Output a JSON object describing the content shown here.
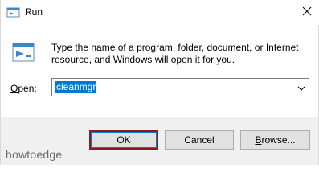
{
  "window": {
    "title": "Run",
    "title_icon": "run-app-icon",
    "close_icon": "close-icon"
  },
  "content": {
    "icon": "run-dialog-icon",
    "description": "Type the name of a program, folder, document, or Internet resource, and Windows will open it for you.",
    "open_label_underlined": "O",
    "open_label_rest": "pen:",
    "open_value": "cleanmgr",
    "dropdown_icon": "chevron-down-icon"
  },
  "buttons": {
    "ok_label": "OK",
    "cancel_label": "Cancel",
    "browse_label_underlined": "B",
    "browse_label_rest": "rowse..."
  },
  "watermark": "howtoedge",
  "colors": {
    "selection": "#0078d7",
    "ok_highlight_border": "#8b1a1a",
    "footer_bg": "#f0f0f0"
  }
}
